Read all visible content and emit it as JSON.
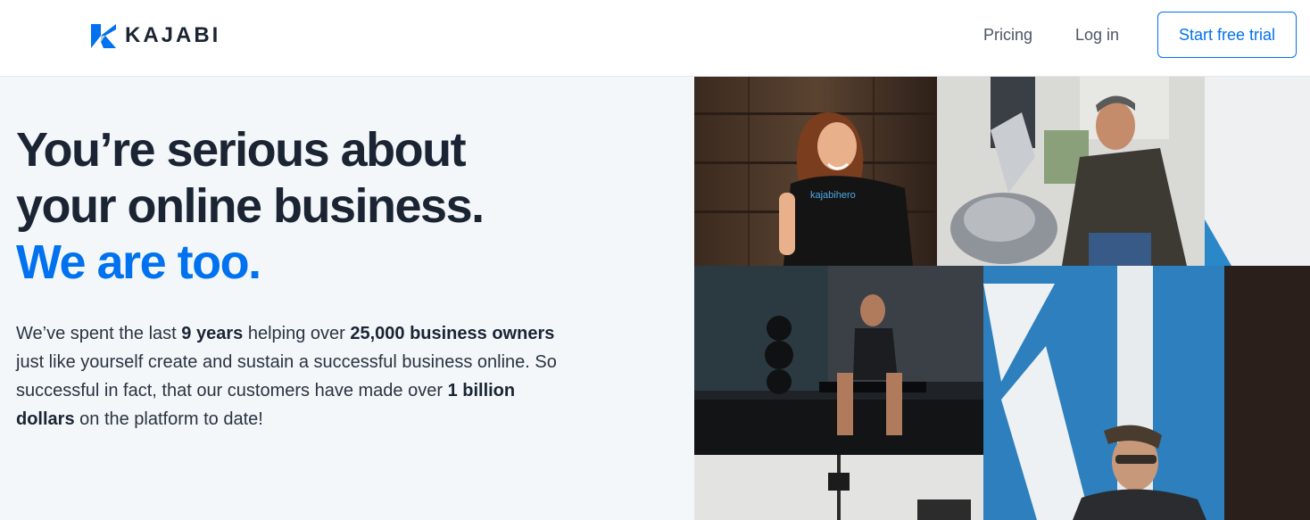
{
  "brand": {
    "name": "KAJABI",
    "logo_icon": "kajabi-k-icon",
    "accent": "#0072ef"
  },
  "nav": {
    "pricing": "Pricing",
    "login": "Log in",
    "cta": "Start free trial"
  },
  "hero": {
    "headline_line1": "You’re serious about",
    "headline_line2": "your online business.",
    "headline_accent": "We are too.",
    "body": {
      "p1": "We’ve spent the last ",
      "b1": "9 years",
      "p2": " helping over ",
      "b2": "25,000 business owners",
      "p3": " just like yourself create and sustain a successful business online. So successful in fact, that our customers have made over ",
      "b3": "1 billion dollars",
      "p4": " on the platform to date!"
    },
    "shirt_text": "kajabihero"
  },
  "collage": {
    "photos": [
      "woman-smiling-photo",
      "man-on-motorcycle-photo",
      "athlete-on-bench-photo",
      "man-with-glasses-photo",
      "studio-light-photo",
      "office-corner-photo"
    ]
  }
}
